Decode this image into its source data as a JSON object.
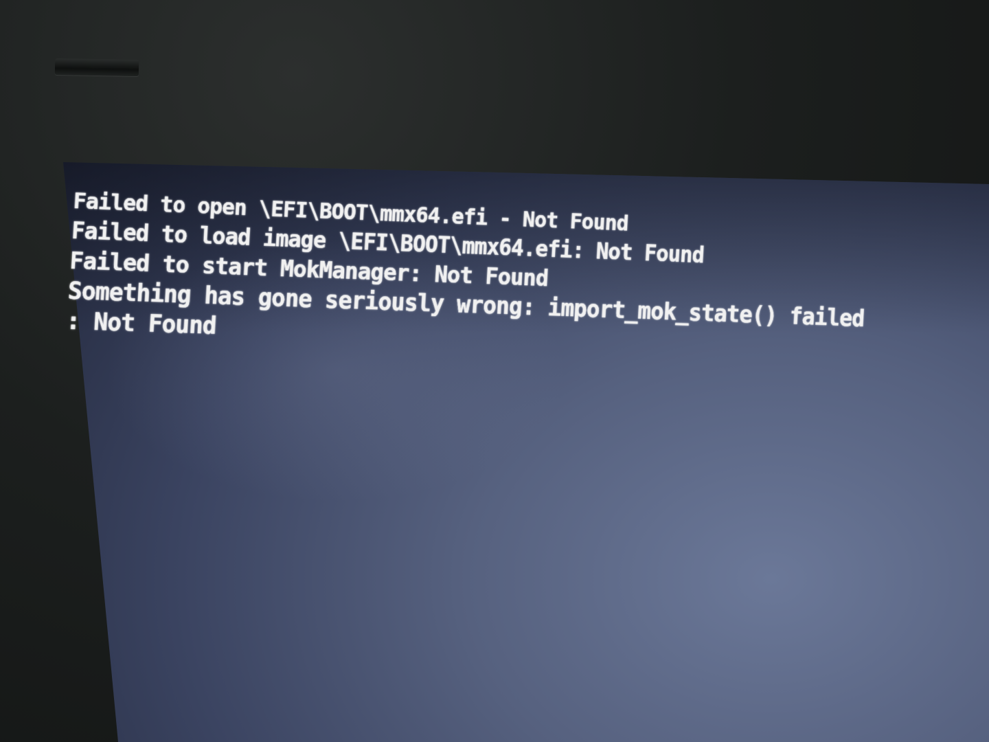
{
  "screen": {
    "background_color": "#56617f",
    "text_color": "#f1f1f1",
    "lines": [
      "Failed to open \\EFI\\BOOT\\mmx64.efi - Not Found",
      "Failed to load image \\EFI\\BOOT\\mmx64.efi: Not Found",
      "Failed to start MokManager: Not Found",
      "Something has gone seriously wrong: import_mok_state() failed",
      ": Not Found"
    ]
  },
  "bezel": {
    "color": "#1c1f1e"
  }
}
